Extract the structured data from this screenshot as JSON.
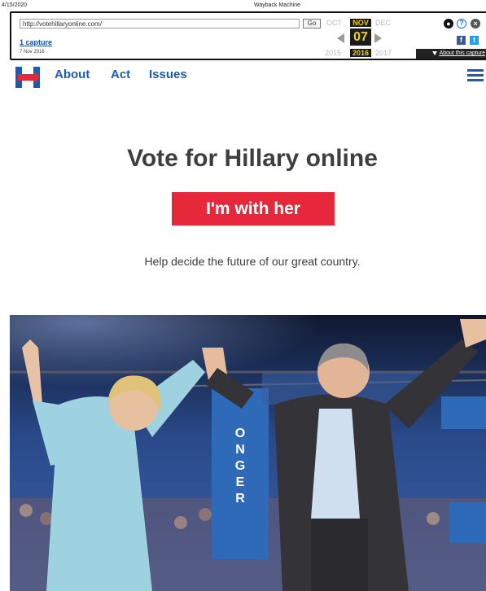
{
  "print_header": {
    "date": "4/15/2020",
    "title": "Wayback Machine"
  },
  "wayback": {
    "url": "http://votehillaryonline.com/",
    "go_label": "Go",
    "captures_label": "1 capture",
    "capture_date": "7 Nov 2016",
    "months": {
      "prev": "OCT",
      "current": "NOV",
      "next": "DEC"
    },
    "day": "07",
    "years": {
      "prev": "2015",
      "current": "2016",
      "next": "2017"
    },
    "about_label": "About this capture"
  },
  "site_nav": {
    "about": "About",
    "act": "Act",
    "issues": "Issues"
  },
  "main": {
    "headline": "Vote for Hillary online",
    "cta_label": "I'm with her",
    "subtext": "Help decide the future of our great country."
  },
  "hero": {
    "banner_text": "ONGER"
  },
  "colors": {
    "brand_blue": "#1c5cb0",
    "cta_red": "#e6283a",
    "wayback_gold": "#f6d000"
  }
}
